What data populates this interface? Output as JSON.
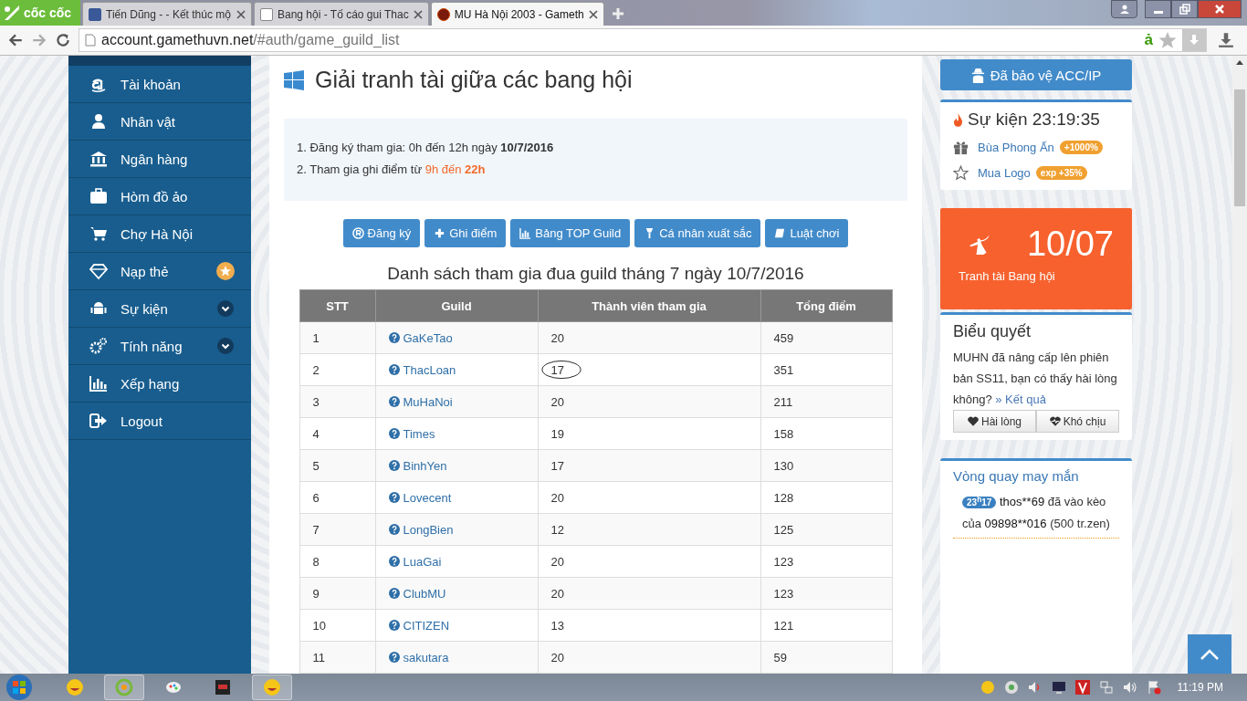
{
  "browser": {
    "brand": "cốc cốc",
    "tabs": [
      {
        "title": "Tiến Dũng - - Kết thúc mộ",
        "selected": false
      },
      {
        "title": "Bang hội - Tố cáo gui Thac",
        "selected": false
      },
      {
        "title": "MU Hà Nội 2003 - Gameth",
        "selected": true
      }
    ],
    "address": {
      "host": "account.gamethuvn.net",
      "path": "/#auth/game_guild_list"
    },
    "address_icon": "ả"
  },
  "sidebar": {
    "items": [
      {
        "label": "Tài khoản",
        "kind": "plain"
      },
      {
        "label": "Nhân vật",
        "kind": "plain"
      },
      {
        "label": "Ngân hàng",
        "kind": "plain"
      },
      {
        "label": "Hòm đồ ảo",
        "kind": "plain"
      },
      {
        "label": "Chợ Hà Nội",
        "kind": "plain"
      },
      {
        "label": "Nạp thẻ",
        "kind": "badge"
      },
      {
        "label": "Sự kiện",
        "kind": "expandable"
      },
      {
        "label": "Tính năng",
        "kind": "expandable"
      },
      {
        "label": "Xếp hạng",
        "kind": "plain"
      },
      {
        "label": "Logout",
        "kind": "plain"
      }
    ]
  },
  "main": {
    "title": "Giải tranh tài giữa các bang hội",
    "info": [
      {
        "text": "1. Đăng ký tham gia: 0h đến 12h ngày **10/7/2016**"
      },
      {
        "text": "2. Tham gia ghi điểm từ ",
        "highlight": "9h đến **22h**"
      }
    ],
    "buttons": [
      "Đăng ký",
      "Ghi điểm",
      "Bảng TOP Guild",
      "Cá nhân xuất sắc",
      "Luật chơi"
    ],
    "table": {
      "title": "Danh sách tham gia đua guild tháng 7 ngày 10/7/2016",
      "columns": [
        "STT",
        "Guild",
        "Thành viên tham gia",
        "Tổng điểm"
      ],
      "rows": [
        {
          "stt": "1",
          "guild": "GaKeTao",
          "members": "20",
          "total": "459",
          "circled": false
        },
        {
          "stt": "2",
          "guild": "ThacLoan",
          "members": "17",
          "total": "351",
          "circled": true
        },
        {
          "stt": "3",
          "guild": "MuHaNoi",
          "members": "20",
          "total": "211",
          "circled": false
        },
        {
          "stt": "4",
          "guild": "Times",
          "members": "19",
          "total": "158",
          "circled": false
        },
        {
          "stt": "5",
          "guild": "BinhYen",
          "members": "17",
          "total": "130",
          "circled": false
        },
        {
          "stt": "6",
          "guild": "Lovecent",
          "members": "20",
          "total": "128",
          "circled": false
        },
        {
          "stt": "7",
          "guild": "LongBien",
          "members": "12",
          "total": "125",
          "circled": false
        },
        {
          "stt": "8",
          "guild": "LuaGai",
          "members": "20",
          "total": "123",
          "circled": false
        },
        {
          "stt": "9",
          "guild": "ClubMU",
          "members": "20",
          "total": "123",
          "circled": false
        },
        {
          "stt": "10",
          "guild": "CITIZEN",
          "members": "13",
          "total": "121",
          "circled": false
        },
        {
          "stt": "11",
          "guild": "sakutara",
          "members": "20",
          "total": "59",
          "circled": false
        }
      ]
    }
  },
  "right": {
    "protect_button": "Đã bảo vệ ACC/IP",
    "event": {
      "title": "Sự kiện 23:19:35",
      "items": [
        {
          "label": "Bùa Phong Ấn",
          "badge": "+1000%"
        },
        {
          "label": "Mua Logo",
          "badge": "exp +35%"
        }
      ]
    },
    "promo": {
      "date": "10/07",
      "caption": "Tranh tài Bang hội"
    },
    "poll": {
      "title": "Biểu quyết",
      "question": "MUHN đã nâng cấp lên phiên bản SS11, bạn có thấy hài lòng không?",
      "link": "» Kết quả",
      "options": [
        "Hài lòng",
        "Khó chịu"
      ]
    },
    "wheel": {
      "title": "Vòng quay may mắn",
      "entries": [
        {
          "time": "23$^{h}$17",
          "user": "thos**69",
          "action": " đã vào kèo của ",
          "target": "09898**016",
          "amount": " (500 tr.zen)"
        }
      ]
    }
  },
  "taskbar": {
    "clock": "11:19 PM"
  }
}
